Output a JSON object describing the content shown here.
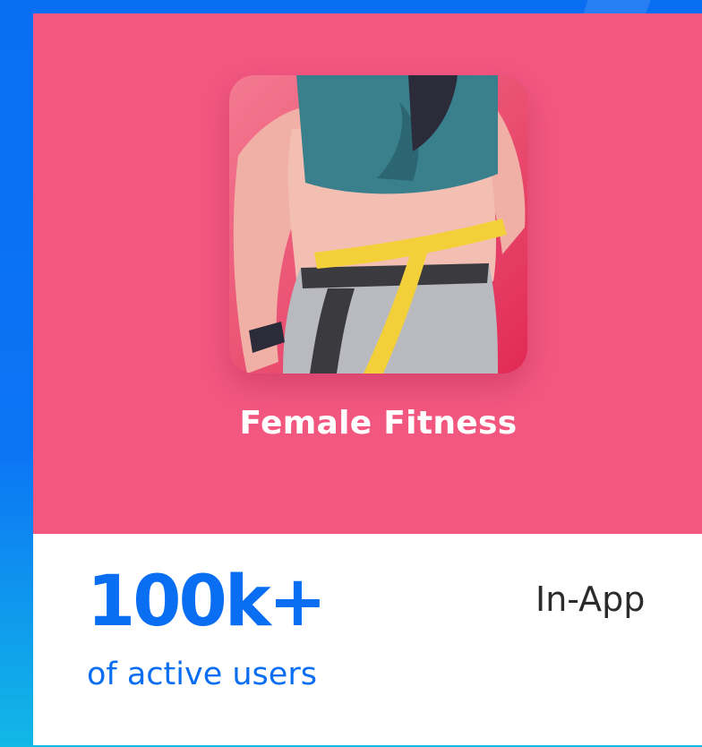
{
  "app": {
    "name": "Female Fitness",
    "icon": "fitness-waist-measure-icon"
  },
  "stats": {
    "value": "100k+",
    "label": "of active users"
  },
  "monetization": {
    "label": "In-App"
  },
  "colors": {
    "background_blue": "#0a6ef2",
    "hero_pink": "#f25780",
    "accent_blue": "#0a6ef2",
    "card_white": "#ffffff"
  }
}
